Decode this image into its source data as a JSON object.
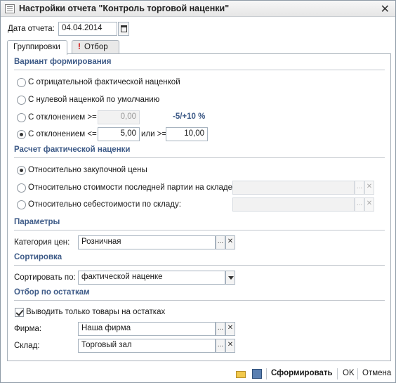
{
  "window": {
    "title": "Настройки отчета \"Контроль торговой наценки\""
  },
  "header": {
    "date_label": "Дата отчета:",
    "date_value": "04.04.2014"
  },
  "tabs": [
    {
      "label": "Группировки",
      "active": true
    },
    {
      "label": "Отбор",
      "active": false,
      "warning_mark": "!"
    }
  ],
  "sections": {
    "variant": "Вариант формирования",
    "calc": "Расчет фактической наценки",
    "params": "Параметры",
    "sort": "Сортировка",
    "stock": "Отбор по остаткам"
  },
  "variant": {
    "opt1": "С отрицательной фактической наценкой",
    "opt2": "С нулевой наценкой по умолчанию",
    "opt3": "С отклонением >=",
    "opt3_value": "0,00",
    "opt3_hint": "-5/+10 %",
    "opt4": "С отклонением <=",
    "opt4_value": "5,00",
    "opt4_or": "или >=",
    "opt4_value2": "10,00",
    "selected": 4
  },
  "calc": {
    "opt1": "Относительно закупочной цены",
    "opt2": "Относительно стоимости последней партии на складе:",
    "opt3": "Относительно себестоимости по складу:",
    "selected": 1
  },
  "params": {
    "category_label": "Категория цен:",
    "category_value": "Розничная"
  },
  "sort": {
    "label": "Сортировать по:",
    "value": "фактической наценке"
  },
  "stock": {
    "checkbox_label": "Выводить только товары на остатках",
    "checked": true,
    "firm_label": "Фирма:",
    "firm_value": "Наша фирма",
    "warehouse_label": "Склад:",
    "warehouse_value": "Торговый зал"
  },
  "buttons": {
    "ellipsis": "...",
    "clear": "✕",
    "generate": "Сформировать",
    "ok": "OK",
    "cancel": "Отмена"
  }
}
